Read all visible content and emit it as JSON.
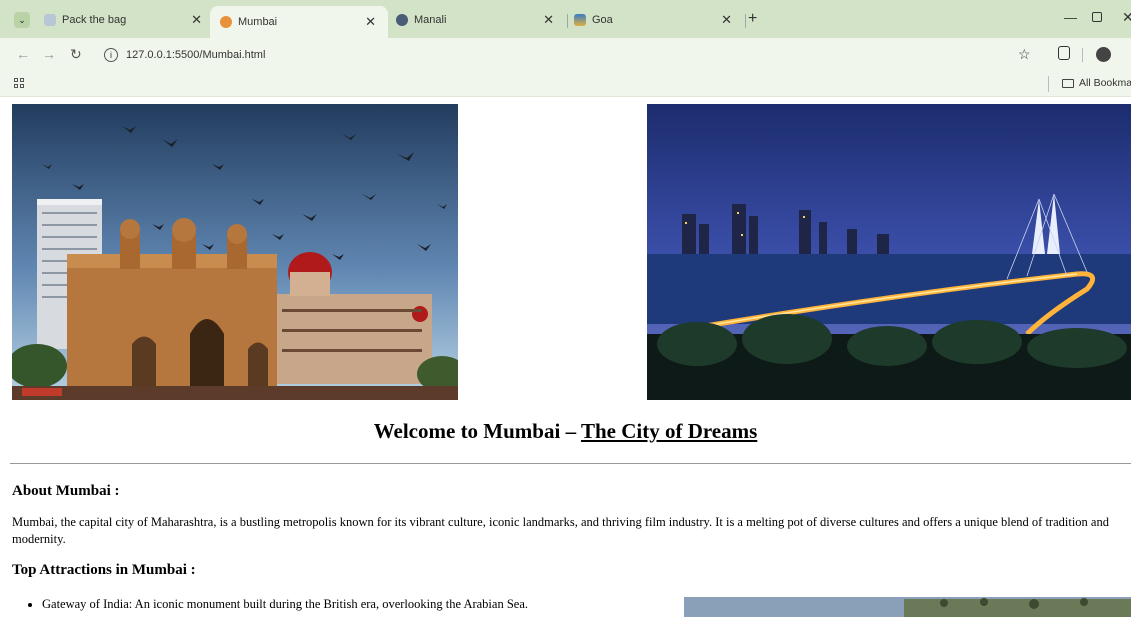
{
  "browser": {
    "tabs": [
      {
        "label": "Pack the bag",
        "active": false
      },
      {
        "label": "Mumbai",
        "active": true
      },
      {
        "label": "Manali",
        "active": false
      },
      {
        "label": "Goa",
        "active": false
      }
    ],
    "url": "127.0.0.1:5500/Mumbai.html",
    "bookmarks_label": "All Bookmarks"
  },
  "page": {
    "title_prefix": "Welcome to Mumbai – ",
    "title_link": "The City of Dreams",
    "about_heading": "About Mumbai :",
    "about_text": "Mumbai, the capital city of Maharashtra, is a bustling metropolis known for its vibrant culture, iconic landmarks, and thriving film industry. It is a melting pot of diverse cultures and offers a unique blend of tradition and modernity.",
    "attractions_heading": "Top Attractions in Mumbai :",
    "attractions": [
      "Gateway of India: An iconic monument built during the British era, overlooking the Arabian Sea."
    ]
  },
  "colors": {
    "tabbar": "#d3e3c8",
    "toolbar": "#f1f6ec"
  }
}
